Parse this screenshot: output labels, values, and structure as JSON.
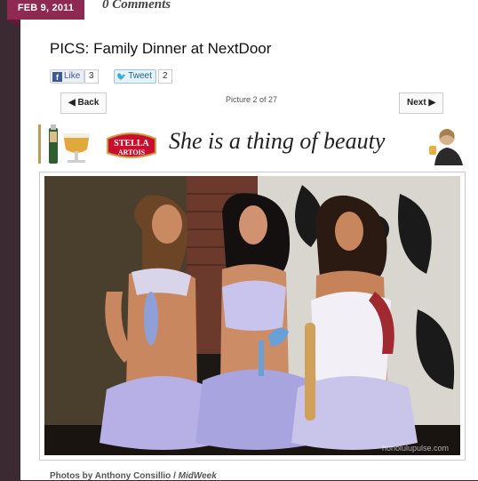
{
  "post": {
    "date": "FEB 9, 2011",
    "comments": "0 Comments",
    "title": "PICS: Family Dinner at NextDoor"
  },
  "share": {
    "like_label": "Like",
    "like_count": "3",
    "tweet_label": "Tweet",
    "tweet_count": "2"
  },
  "gallery": {
    "back_label": "◀ Back",
    "next_label": "Next ▶",
    "position_text": "Picture 2 of 27"
  },
  "ad": {
    "brand_top": "STELLA",
    "brand_bottom": "ARTOIS",
    "tagline": "She is a thing of beauty"
  },
  "photo": {
    "watermark": "honolulupulse.com",
    "credit_prefix": "Photos by Anthony Consillio / ",
    "credit_source": "MidWeek"
  },
  "colors": {
    "sidebar_bg": "#3c2a32",
    "date_tab": "#8e2a52",
    "facebook_blue": "#3b5998",
    "twitter_blue": "#2aa3d6",
    "stella_red": "#c8102e",
    "stella_gold": "#c9a24a"
  }
}
